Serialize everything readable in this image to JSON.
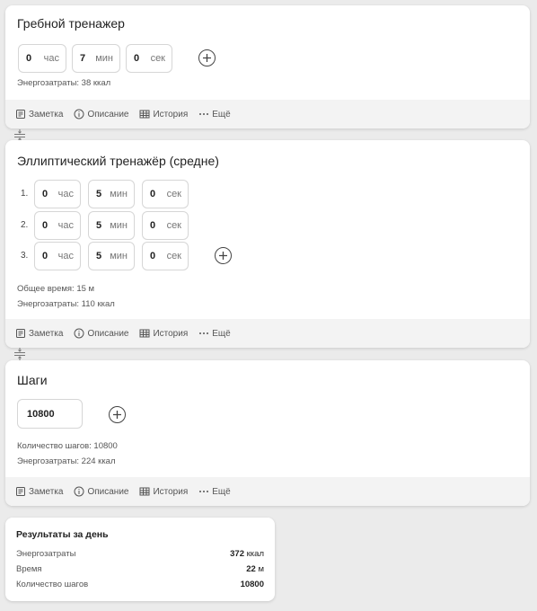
{
  "rowing": {
    "title": "Гребной тренажер",
    "hours": "0",
    "hours_unit": "час",
    "minutes": "7",
    "minutes_unit": "мин",
    "seconds": "0",
    "seconds_unit": "сек",
    "energy": "Энергозатраты: 38 ккал"
  },
  "elliptical": {
    "title": "Эллиптический тренажёр (средне)",
    "rows": [
      {
        "num": "1.",
        "hours": "0",
        "minutes": "5",
        "seconds": "0"
      },
      {
        "num": "2.",
        "hours": "0",
        "minutes": "5",
        "seconds": "0"
      },
      {
        "num": "3.",
        "hours": "0",
        "minutes": "5",
        "seconds": "0"
      }
    ],
    "hours_unit": "час",
    "minutes_unit": "мин",
    "seconds_unit": "сек",
    "total_time": "Общее время: 15 м",
    "energy": "Энергозатраты: 110 ккал"
  },
  "steps": {
    "title": "Шаги",
    "value": "10800",
    "count": "Количество шагов: 10800",
    "energy": "Энергозатраты: 224 ккал"
  },
  "footer": {
    "note": "Заметка",
    "description": "Описание",
    "history": "История",
    "more": "Ещё"
  },
  "summary": {
    "title": "Результаты за день",
    "rows": [
      {
        "label": "Энергозатраты",
        "value": "372",
        "unit": "ккал"
      },
      {
        "label": "Время",
        "value": "22",
        "unit": "м"
      },
      {
        "label": "Количество шагов",
        "value": "10800",
        "unit": ""
      }
    ]
  },
  "icons": {
    "plus": "plus-circle-icon",
    "note": "note-icon",
    "info": "info-icon",
    "history": "table-icon",
    "more": "dots-icon",
    "handle": "drag-handle-icon"
  }
}
